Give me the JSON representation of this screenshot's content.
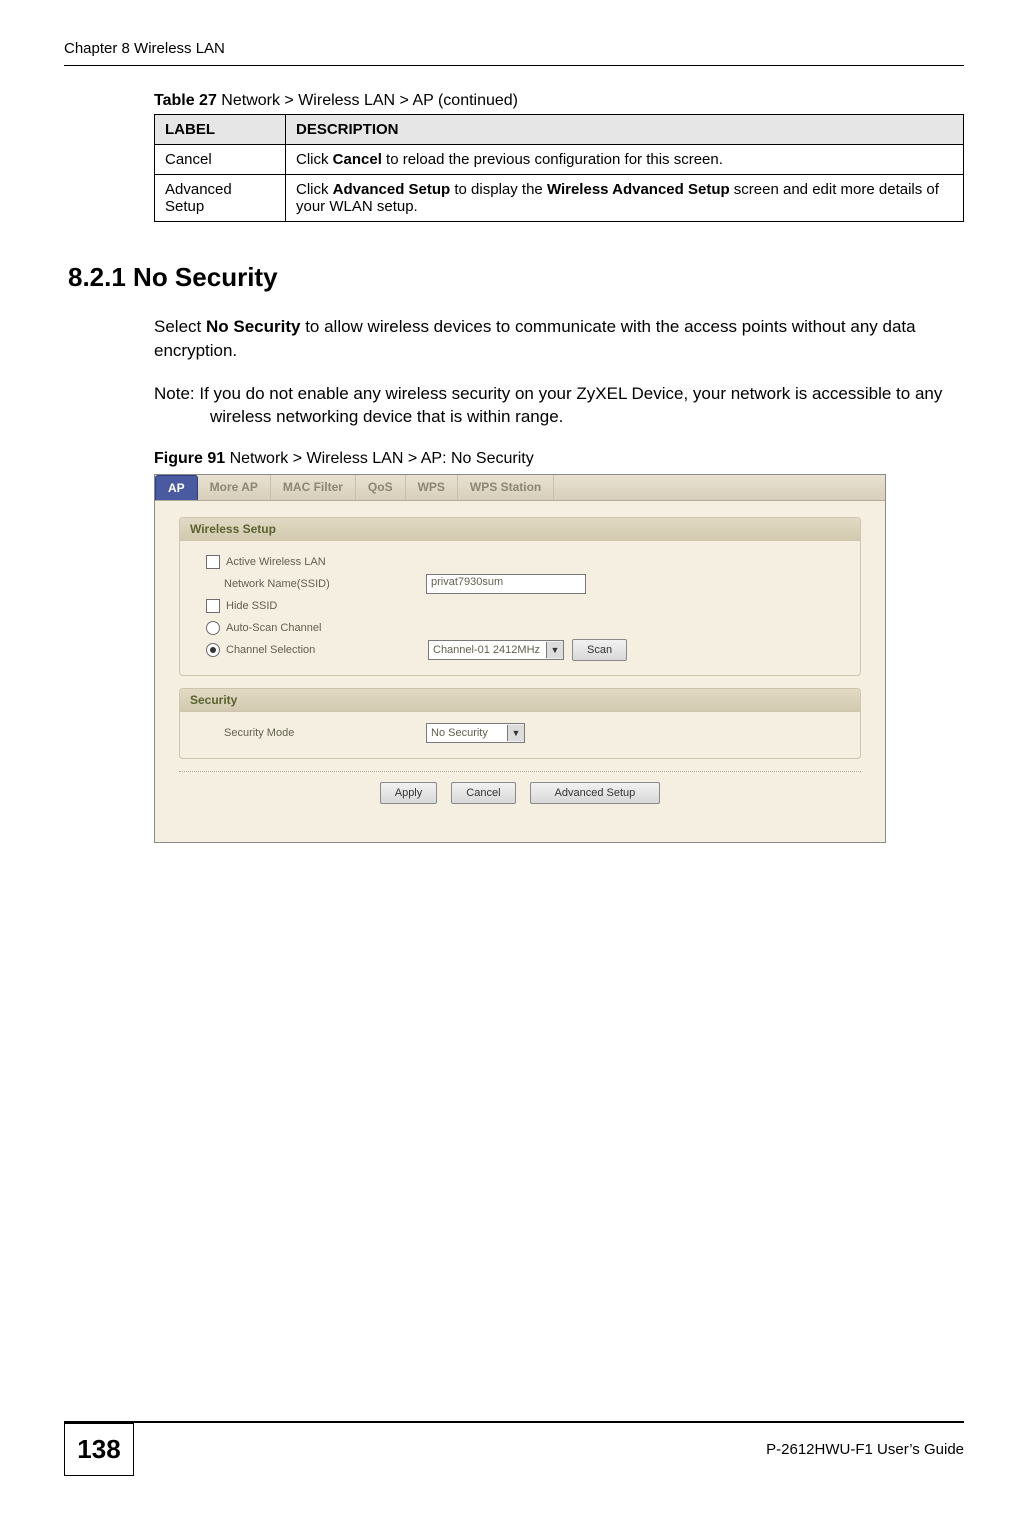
{
  "header": {
    "left": "Chapter 8 Wireless LAN"
  },
  "table": {
    "caption_prefix": "Table 27",
    "caption_rest": "   Network > Wireless LAN > AP (continued)",
    "col1": "LABEL",
    "col2": "DESCRIPTION",
    "rows": [
      {
        "label": "Cancel",
        "desc_pre": "Click ",
        "desc_b1": "Cancel",
        "desc_mid": " to reload the previous configuration for this screen.",
        "desc_b2": "",
        "desc_post": ""
      },
      {
        "label": "Advanced Setup",
        "desc_pre": "Click ",
        "desc_b1": "Advanced Setup",
        "desc_mid": " to display the ",
        "desc_b2": "Wireless Advanced Setup",
        "desc_post": " screen and edit more details of your WLAN setup."
      }
    ]
  },
  "section": {
    "heading": "8.2.1  No Security"
  },
  "body": {
    "p1_pre": "Select ",
    "p1_b": "No Security",
    "p1_post": " to allow wireless devices to communicate with the access points without any data encryption.",
    "note": "Note: If you do not enable any wireless security on your ZyXEL Device, your network is accessible to any wireless networking device that is within range."
  },
  "figure": {
    "caption_prefix": "Figure 91",
    "caption_rest": "   Network > Wireless LAN > AP: No Security",
    "tabs": [
      "AP",
      "More AP",
      "MAC Filter",
      "QoS",
      "WPS",
      "WPS Station"
    ],
    "active_tab_index": 0,
    "wireless": {
      "group": "Wireless Setup",
      "active_label": "Active Wireless LAN",
      "active_checked": false,
      "ssid_label": "Network Name(SSID)",
      "ssid_value": "privat7930sum",
      "hide_label": "Hide SSID",
      "hide_checked": false,
      "autoscan_label": "Auto-Scan Channel",
      "autoscan_selected": false,
      "chansel_label": "Channel Selection",
      "chansel_selected": true,
      "channel_value": "Channel-01 2412MHz",
      "scan_btn": "Scan"
    },
    "security": {
      "group": "Security",
      "mode_label": "Security Mode",
      "mode_value": "No Security"
    },
    "buttons": {
      "apply": "Apply",
      "cancel": "Cancel",
      "adv": "Advanced Setup"
    }
  },
  "footer": {
    "page_number": "138",
    "guide": "P-2612HWU-F1 User’s Guide"
  }
}
